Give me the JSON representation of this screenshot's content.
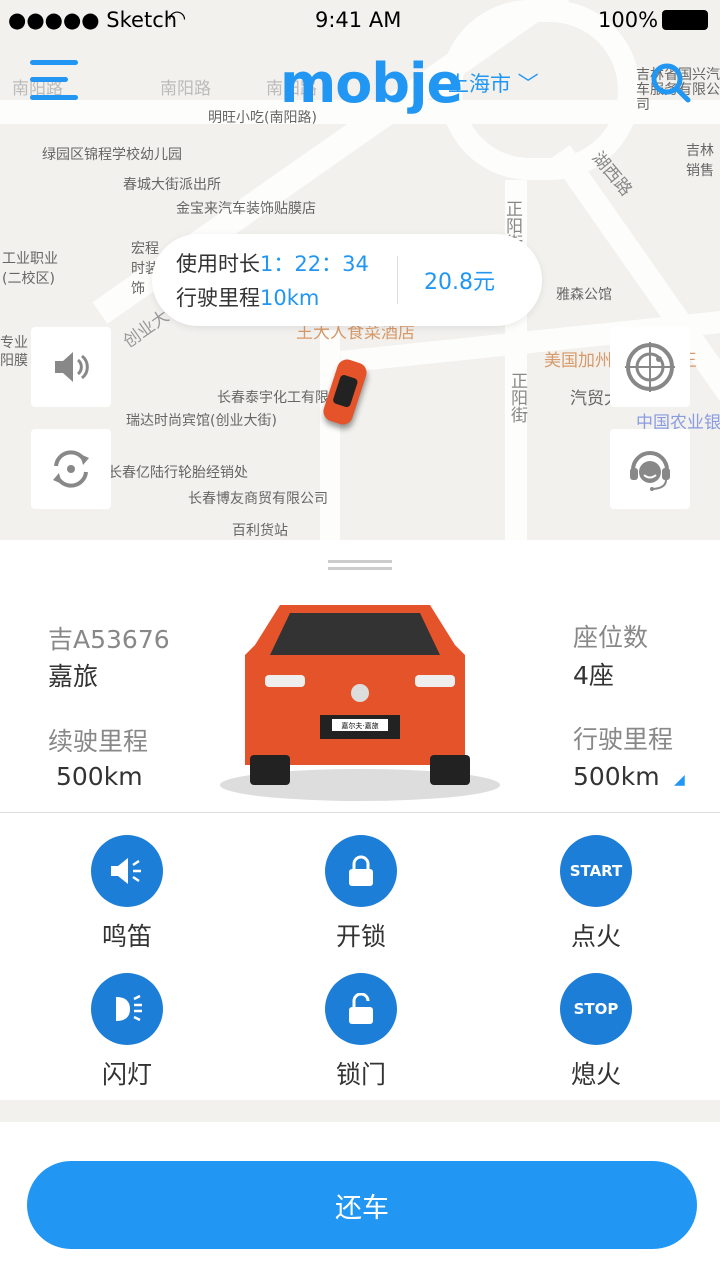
{
  "status_bar": {
    "carrier": "●●●●● Sketch",
    "time": "9:41 AM",
    "battery": "100%"
  },
  "header": {
    "logo": "mobje",
    "city": "上海市",
    "icons": [
      "menu-icon",
      "search-icon",
      "chevron-down-icon"
    ]
  },
  "map": {
    "labels": [
      "南阳路",
      "南阳路",
      "南阳路",
      "明旺小吃(南阳路)",
      "绿园区锦程学校幼儿园",
      "春城大街派出所",
      "金宝来汽车装饰贴膜店",
      "宏程时装饰",
      "工业职业(二校区)",
      "湖西路",
      "正阳街",
      "雅森公馆",
      "吉林省国兴汽车服务有限公司",
      "吉林销售",
      "创业大街",
      "王大人食菜酒店",
      "美国加州牛肉面大王",
      "汽贸大厦",
      "中国农业银行自助",
      "长春泰宇化工有限公司",
      "瑞达时尚宾馆(创业大街)",
      "长春亿陆行轮胎经销处",
      "长春博友商贸有限公司",
      "百利货站",
      "正阳街",
      "专业阳膜"
    ],
    "trip": {
      "duration_label": "使用时长",
      "duration": "1：22：34",
      "distance_label": "行驶里程",
      "distance": "10km",
      "fee": "20.8元"
    },
    "buttons": [
      "sound-icon",
      "refresh-icon",
      "radar-icon",
      "customer-service-icon"
    ]
  },
  "vehicle": {
    "plate": "吉A53676",
    "model": "嘉旅",
    "range_label": "续驶里程",
    "range": "500km",
    "seats_label": "座位数",
    "seats": "4座",
    "mileage_label": "行驶里程",
    "mileage": "500km",
    "badge": "嘉尔夫·嘉旅",
    "car_color": "#e4532a"
  },
  "actions": [
    {
      "label": "鸣笛",
      "icon": "horn-icon"
    },
    {
      "label": "开锁",
      "icon": "lock-icon"
    },
    {
      "label": "点火",
      "icon": "start-icon",
      "text": "START"
    },
    {
      "label": "闪灯",
      "icon": "headlight-icon"
    },
    {
      "label": "锁门",
      "icon": "unlock-icon"
    },
    {
      "label": "熄火",
      "icon": "stop-icon",
      "text": "STOP"
    }
  ],
  "return_button": "还车",
  "colors": {
    "accent": "#2196f3",
    "action": "#1c7ed6"
  }
}
